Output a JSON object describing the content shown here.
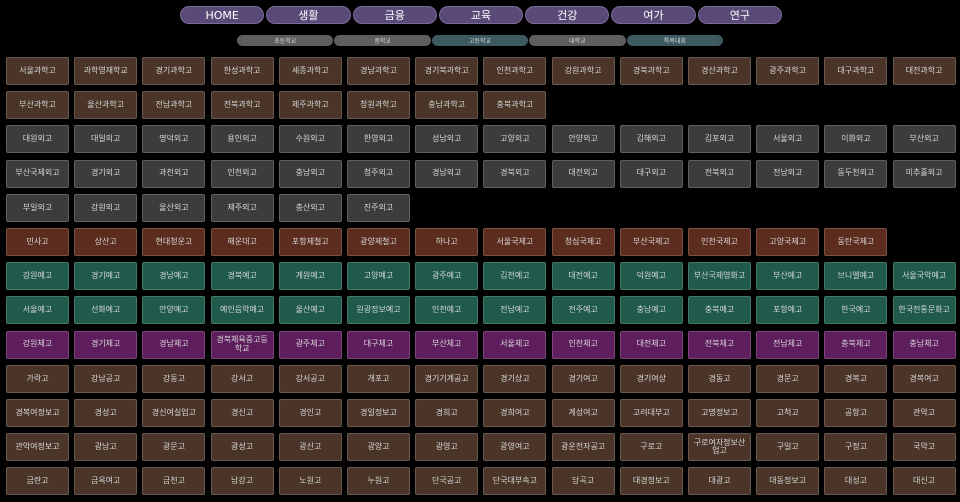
{
  "colors": {
    "nav_bg": "#5a4a78",
    "brown": "#4a3528",
    "gray": "#3c3c3e",
    "rust": "#5c2c1e",
    "green": "#1f5a4a",
    "purple": "#5e1e5e",
    "sub_gray": "#5e5e5e",
    "sub_teal": "#3c5a60"
  },
  "nav": [
    "HOME",
    "생활",
    "금융",
    "교육",
    "건강",
    "여가",
    "연구"
  ],
  "subnav": [
    {
      "label": "초등학교",
      "color": "sub_gray"
    },
    {
      "label": "중학교",
      "color": "sub_gray"
    },
    {
      "label": "고등학교",
      "color": "sub_teal"
    },
    {
      "label": "대학교",
      "color": "sub_gray"
    },
    {
      "label": "특목대회",
      "color": "sub_teal"
    }
  ],
  "rows": [
    {
      "color": "brown",
      "items": [
        "서울과학고",
        "과학영재학교",
        "경기과학고",
        "한성과학고",
        "세종과학고",
        "경남과학고",
        "경기북과학고",
        "인천과학고",
        "강원과학고",
        "경북과학고",
        "경산과학고",
        "광주과학고",
        "대구과학고",
        "대전과학고"
      ]
    },
    {
      "color": "brown",
      "items": [
        "부산과학고",
        "울산과학고",
        "전남과학고",
        "전북과학고",
        "제주과학고",
        "창원과학고",
        "충남과학고",
        "충북과학고"
      ]
    },
    {
      "color": "gray",
      "items": [
        "대원외고",
        "대일외고",
        "명덕외고",
        "용인외고",
        "수원외고",
        "한영외고",
        "성남외고",
        "고양외고",
        "안양외고",
        "김해외고",
        "김포외고",
        "서울외고",
        "이화외고",
        "부산외고"
      ]
    },
    {
      "color": "gray",
      "items": [
        "부산국제외고",
        "경기외고",
        "과천외고",
        "인천외고",
        "충남외고",
        "청주외고",
        "경남외고",
        "경북외고",
        "대전외고",
        "대구외고",
        "전북외고",
        "전남외고",
        "동두천외고",
        "미추홀외고"
      ]
    },
    {
      "color": "gray",
      "items": [
        "부일외고",
        "강원외고",
        "울산외고",
        "제주외고",
        "충산외고",
        "진주외고"
      ]
    },
    {
      "color": "rust",
      "items": [
        "민사고",
        "상산고",
        "현대청운고",
        "해운대고",
        "포항제철고",
        "광양제철고",
        "하나고",
        "서울국제고",
        "청심국제고",
        "부산국제고",
        "인천국제고",
        "고양국제고",
        "동탄국제고"
      ]
    },
    {
      "color": "green",
      "items": [
        "강원예고",
        "경기예고",
        "경남예고",
        "경북예고",
        "계원예고",
        "고양예고",
        "광주예고",
        "김천예고",
        "대전예고",
        "덕원예고",
        "부산국제영화고",
        "부산예고",
        "브니엘예고",
        "서울국악예고"
      ]
    },
    {
      "color": "green",
      "items": [
        "서울예고",
        "선화예고",
        "안양예고",
        "예인음악예고",
        "울산예고",
        "원광정보예고",
        "인천예고",
        "전남예고",
        "전주예고",
        "충남예고",
        "충북예고",
        "포항예고",
        "한국예고",
        "한국전통문화고"
      ]
    },
    {
      "color": "purple",
      "items": [
        "강원체고",
        "경기체고",
        "경남체고",
        "경북체육중고등학교",
        "광주체고",
        "대구체고",
        "부산체고",
        "서울체고",
        "인천체고",
        "대전체고",
        "전북체고",
        "전남체고",
        "충북체고",
        "충남체고"
      ]
    },
    {
      "color": "brown",
      "items": [
        "가락고",
        "강남공고",
        "강동고",
        "강서고",
        "강서공고",
        "개포고",
        "경기기계공고",
        "경기상고",
        "경기여고",
        "경기여상",
        "경동고",
        "경문고",
        "경복고",
        "경복여고"
      ]
    },
    {
      "color": "brown",
      "items": [
        "경복여정보고",
        "경성고",
        "경신여실업고",
        "경신고",
        "경인고",
        "경일정보고",
        "경희고",
        "경희여고",
        "계성여고",
        "고려대부고",
        "고명정보고",
        "고척고",
        "공항고",
        "관악고"
      ]
    },
    {
      "color": "brown",
      "items": [
        "관악여정보고",
        "광남고",
        "광문고",
        "광성고",
        "광신고",
        "광양고",
        "광영고",
        "광영여고",
        "광운전자공고",
        "구로고",
        "구로여자정보산업고",
        "구일고",
        "구정고",
        "국악고"
      ]
    },
    {
      "color": "brown",
      "items": [
        "금란고",
        "금옥여고",
        "금천고",
        "남강고",
        "노원고",
        "누원고",
        "단국공고",
        "단국대부속고",
        "당곡고",
        "대경정보고",
        "대광고",
        "대동정보고",
        "대성고",
        "대신고"
      ]
    }
  ]
}
